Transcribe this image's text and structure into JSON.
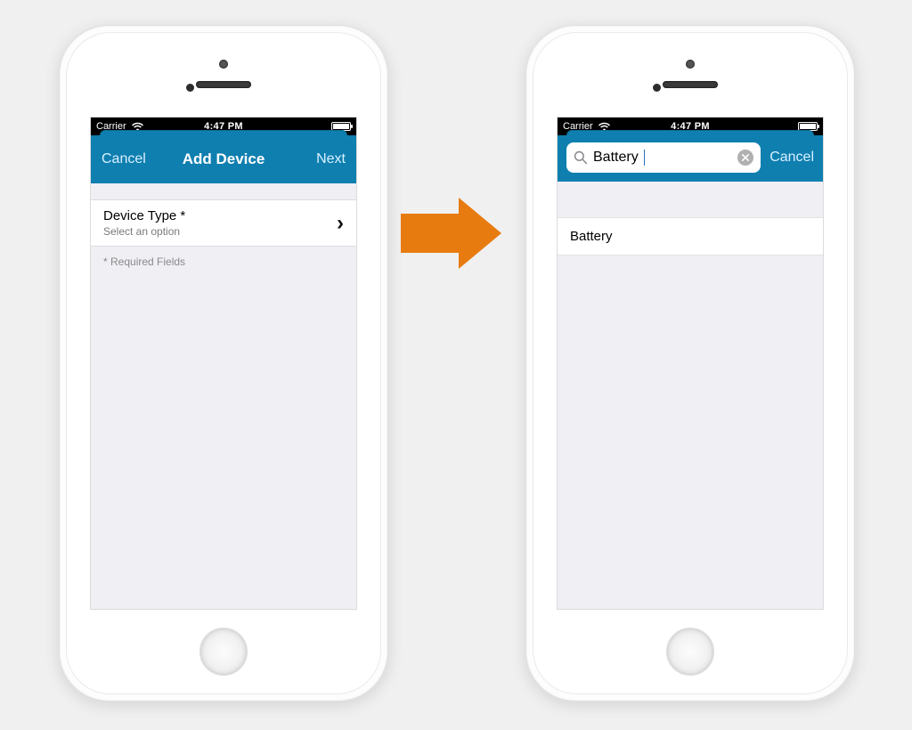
{
  "status_bar": {
    "carrier": "Carrier",
    "time": "4:47 PM"
  },
  "phone_left": {
    "nav": {
      "cancel": "Cancel",
      "title": "Add Device",
      "next": "Next"
    },
    "form": {
      "row": {
        "label": "Device Type *",
        "placeholder": "Select an option"
      },
      "required_hint": "* Required Fields"
    }
  },
  "phone_right": {
    "search": {
      "value": "Battery",
      "cancel": "Cancel"
    },
    "results": [
      "Battery"
    ]
  }
}
